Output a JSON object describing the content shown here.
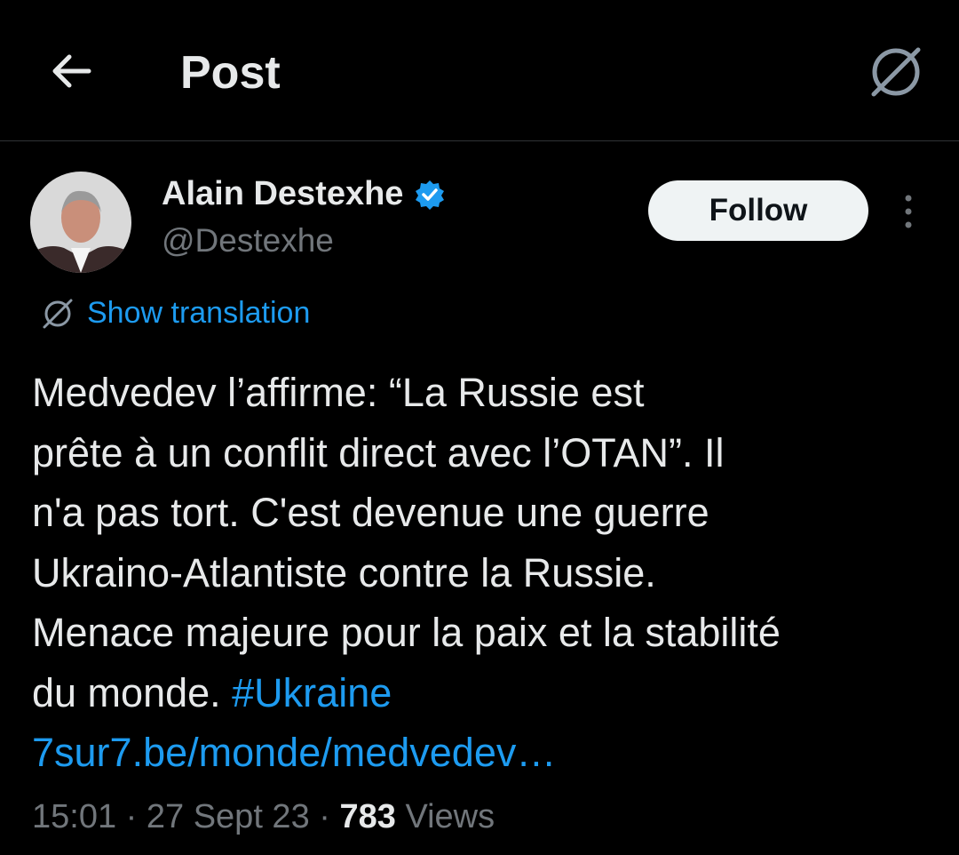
{
  "header": {
    "title": "Post",
    "back_icon": "arrow-left-icon",
    "translate_icon": "globe-slash-icon"
  },
  "author": {
    "name": "Alain Destexhe",
    "handle": "@Destexhe",
    "verified_icon": "verified-badge-icon",
    "follow_label": "Follow",
    "more_icon": "vertical-dots-icon"
  },
  "translation": {
    "label": "Show translation"
  },
  "post": {
    "line1": "Medvedev l’affirme: “La Russie est",
    "line2": "prête à un conflit direct avec l’OTAN”. Il",
    "line3": "n'a pas tort. C'est devenue une guerre",
    "line4": "Ukraino-Atlantiste contre la Russie.",
    "line5": "Menace majeure pour la paix et la stabilité",
    "line6_text": "du monde. ",
    "hashtag": "#Ukraine",
    "link": "7sur7.be/monde/medvedev…"
  },
  "meta": {
    "time": "15:01",
    "sep1": " · ",
    "date": "27 Sept 23",
    "sep2": " · ",
    "views_count": "783",
    "views_label": " Views"
  },
  "colors": {
    "background": "#000000",
    "accent": "#1d9bf0",
    "text": "#e7e9ea",
    "muted": "#71767b"
  }
}
